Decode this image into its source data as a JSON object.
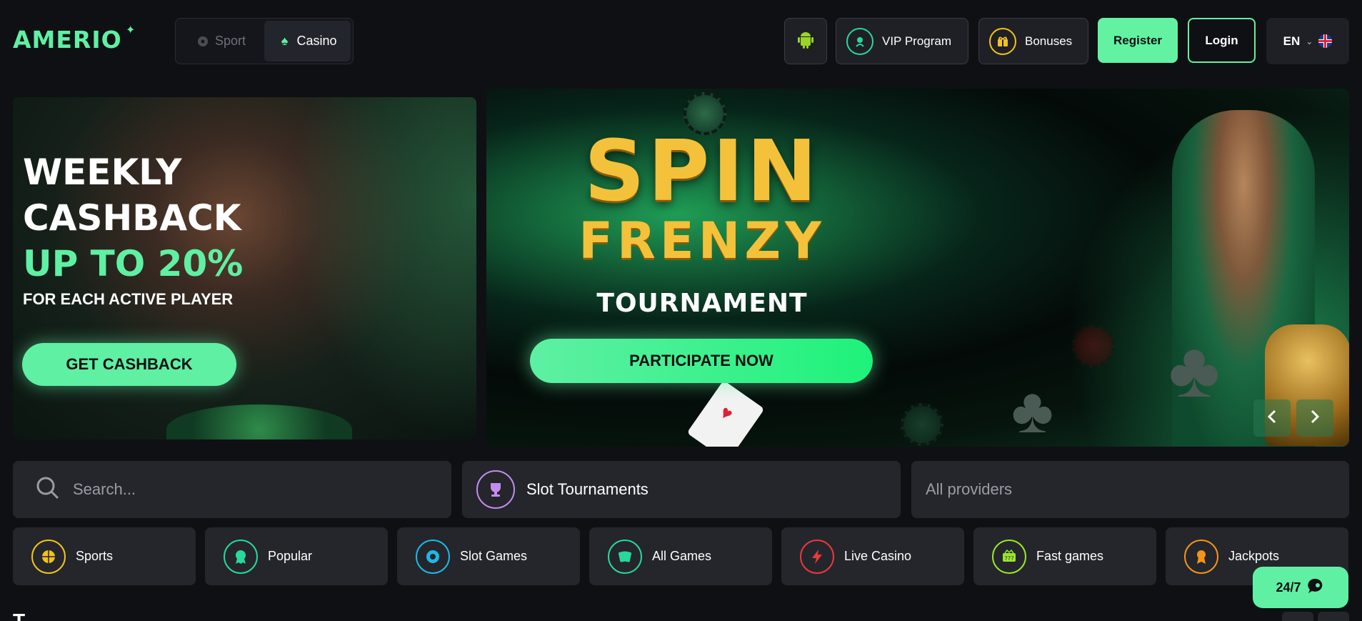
{
  "header": {
    "logo_text": "AMERIO",
    "mode_tabs": [
      {
        "label": "Sport",
        "active": false
      },
      {
        "label": "Casino",
        "active": true
      }
    ],
    "vip_label": "VIP Program",
    "bonuses_label": "Bonuses",
    "register_label": "Register",
    "login_label": "Login",
    "language": "EN"
  },
  "banners": {
    "cashback": {
      "line1": "WEEKLY",
      "line2": "CASHBACK",
      "line3": "UP TO 20%",
      "subtitle": "FOR EACH ACTIVE PLAYER",
      "button": "GET CASHBACK"
    },
    "tournament": {
      "title1": "SPIN",
      "title2": "FRENZY",
      "title3": "TOURNAMENT",
      "button": "PARTICIPATE NOW"
    }
  },
  "filters": {
    "search_placeholder": "Search...",
    "tournaments_label": "Slot Tournaments",
    "providers_placeholder": "All providers"
  },
  "categories": [
    {
      "label": "Sports",
      "icon": "basketball-icon",
      "color": "#f2c21b"
    },
    {
      "label": "Popular",
      "icon": "medal-icon",
      "color": "#27d99a"
    },
    {
      "label": "Slot Games",
      "icon": "slot-icon",
      "color": "#1fb7e8"
    },
    {
      "label": "All Games",
      "icon": "cards-icon",
      "color": "#27d99a"
    },
    {
      "label": "Live Casino",
      "icon": "lightning-icon",
      "color": "#e83a3a"
    },
    {
      "label": "Fast games",
      "icon": "slot-machine-icon",
      "color": "#9ae62a"
    },
    {
      "label": "Jackpots",
      "icon": "award-icon",
      "color": "#f29418"
    }
  ],
  "support_label": "24/7",
  "section_peek": "T",
  "colors": {
    "accent": "#5ff0a3",
    "background": "#0f1014",
    "panel": "#24262c"
  }
}
